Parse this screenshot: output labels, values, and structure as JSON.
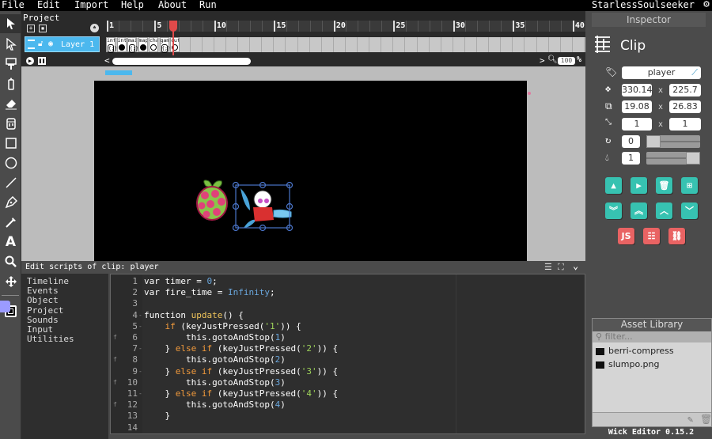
{
  "menu": {
    "items": [
      "File",
      "Edit",
      "Import",
      "Help",
      "About",
      "Run"
    ],
    "username": "StarlessSoulseeker"
  },
  "toolbar": {
    "tools": [
      "cursor-icon",
      "path-cursor-icon",
      "brush-icon",
      "pencil-icon",
      "eraser-icon",
      "fill-bucket-icon",
      "rectangle-icon",
      "ellipse-icon",
      "line-icon",
      "pen-icon",
      "eyedropper-icon",
      "text-icon",
      "zoom-icon",
      "pan-icon"
    ],
    "fill_color": "#9b9bff",
    "stroke_color": "#000000"
  },
  "timeline": {
    "project_label": "Project",
    "layer_name": "Layer 1",
    "ruler_labels": [
      "1",
      "5",
      "10",
      "15",
      "20",
      "25",
      "30",
      "35",
      "40"
    ],
    "keyframes": [
      {
        "label": "intr",
        "type": "script"
      },
      {
        "label": "intr",
        "type": "filled"
      },
      {
        "label": "main",
        "type": "script"
      },
      {
        "label": "map",
        "type": "filled"
      },
      {
        "label": "chag",
        "type": "empty"
      },
      {
        "label": "game",
        "type": "script"
      },
      {
        "label": "cuts",
        "type": "empty"
      }
    ],
    "playhead_frame": 6,
    "zoom_value": "100",
    "zoom_unit": "%"
  },
  "scripts": {
    "title": "Edit scripts of clip: player",
    "nav": [
      "Timeline",
      "Events",
      "Object",
      "Project",
      "Sounds",
      "Input",
      "Utilities"
    ],
    "lines": [
      {
        "n": "1",
        "fold": "",
        "html": "var timer = <span class='num'>0</span>;"
      },
      {
        "n": "2",
        "fold": "",
        "html": "var fire_time = <span class='con'>Infinity</span>;"
      },
      {
        "n": "3",
        "fold": "",
        "html": ""
      },
      {
        "n": "4",
        "fold": "-",
        "html": "function <span class='fn'>update</span>() {"
      },
      {
        "n": "5",
        "fold": "-",
        "html": "    <span class='kw'>if</span> (keyJustPressed(<span class='str'>'1'</span>)) {"
      },
      {
        "n": "6",
        "fold": "f",
        "html": "        this.gotoAndStop(<span class='num'>1</span>)"
      },
      {
        "n": "7",
        "fold": "-",
        "html": "    } <span class='kw'>else if</span> (keyJustPressed(<span class='str'>'2'</span>)) {"
      },
      {
        "n": "8",
        "fold": "f",
        "html": "        this.gotoAndStop(<span class='num'>2</span>)"
      },
      {
        "n": "9",
        "fold": "-",
        "html": "    } <span class='kw'>else if</span> (keyJustPressed(<span class='str'>'3'</span>)) {"
      },
      {
        "n": "10",
        "fold": "f",
        "html": "        this.gotoAndStop(<span class='num'>3</span>)"
      },
      {
        "n": "11",
        "fold": "-",
        "html": "    } <span class='kw'>else if</span> (keyJustPressed(<span class='str'>'4'</span>)) {"
      },
      {
        "n": "12",
        "fold": "f",
        "html": "        this.gotoAndStop(<span class='num'>4</span>)"
      },
      {
        "n": "13",
        "fold": "",
        "html": "    }"
      },
      {
        "n": "14",
        "fold": "",
        "html": ""
      }
    ]
  },
  "inspector": {
    "header": "Inspector",
    "object_type": "Clip",
    "name": "player",
    "x": "330.14",
    "y": "225.7",
    "width": "19.08",
    "height": "26.83",
    "scale_x": "1",
    "scale_y": "1",
    "rotation": "0",
    "opacity": "1",
    "rotation_slider_fraction": 0.0,
    "opacity_slider_fraction": 1.0,
    "separator": "x",
    "buttons_row1": [
      "flip-horizontal",
      "flip-vertical",
      "delete",
      "duplicate"
    ],
    "buttons_row2": [
      "send-to-back",
      "bring-to-front",
      "move-forward",
      "move-backward"
    ],
    "buttons_row3": [
      "JS",
      "edit-timeline",
      "break-apart"
    ],
    "js_label": "JS"
  },
  "assets": {
    "header": "Asset Library",
    "filter_placeholder": "filter...",
    "items": [
      "berri-compress",
      "slumpo.png"
    ]
  },
  "version": "Wick Editor 0.15.2",
  "colors": {
    "accent_blue": "#4cb8ee",
    "teal": "#37c2b1",
    "red": "#e96363",
    "playhead": "#e04a4a"
  }
}
